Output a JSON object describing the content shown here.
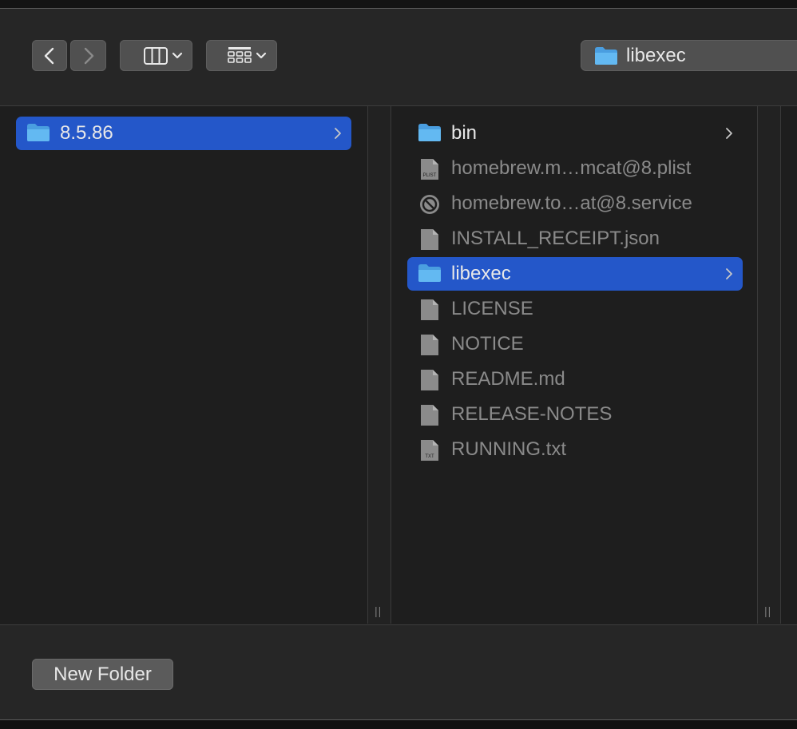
{
  "toolbar": {
    "back_icon": "chevron-left-icon",
    "forward_icon": "chevron-right-icon",
    "view_icon": "columns-view-icon",
    "group_icon": "grid-group-icon",
    "path_popup_label": "libexec"
  },
  "columns": [
    {
      "items": [
        {
          "label": "8.5.86",
          "kind": "folder",
          "selected": true,
          "has_children": true
        }
      ]
    },
    {
      "items": [
        {
          "label": "bin",
          "kind": "folder",
          "selected": false,
          "has_children": true
        },
        {
          "label": "homebrew.m…mcat@8.plist",
          "kind": "plist",
          "selected": false
        },
        {
          "label": "homebrew.to…at@8.service",
          "kind": "blocked",
          "selected": false
        },
        {
          "label": "INSTALL_RECEIPT.json",
          "kind": "file",
          "selected": false
        },
        {
          "label": "libexec",
          "kind": "folder",
          "selected": true,
          "has_children": true
        },
        {
          "label": "LICENSE",
          "kind": "file",
          "selected": false
        },
        {
          "label": "NOTICE",
          "kind": "file",
          "selected": false
        },
        {
          "label": "README.md",
          "kind": "file",
          "selected": false
        },
        {
          "label": "RELEASE-NOTES",
          "kind": "file",
          "selected": false
        },
        {
          "label": "RUNNING.txt",
          "kind": "txt",
          "selected": false
        }
      ]
    }
  ],
  "column_resize_grip": "||",
  "icon_badges": {
    "plist": "PLIST",
    "txt": "TXT"
  },
  "bottom_bar": {
    "new_folder_label": "New Folder"
  },
  "colors": {
    "selection": "#2457c9",
    "folder_blue": "#5fb4f0",
    "background": "#1e1e1e"
  }
}
